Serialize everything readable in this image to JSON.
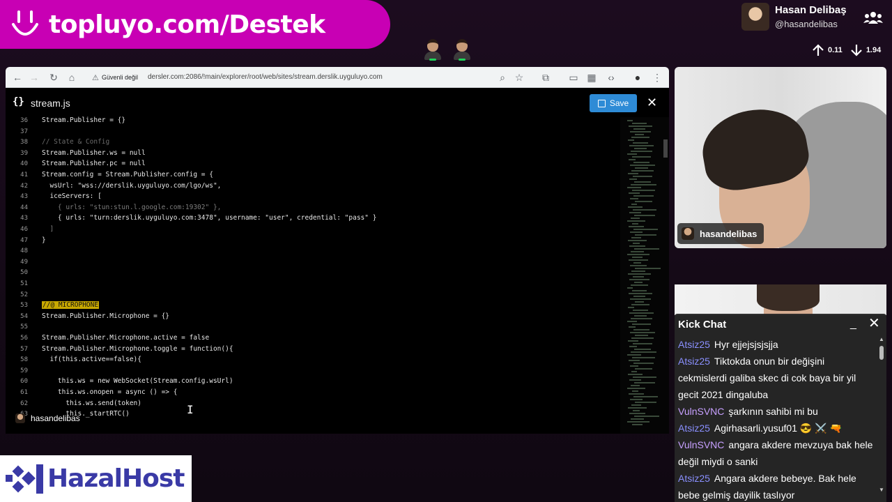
{
  "banner": {
    "text": "topluyo.com/Destek"
  },
  "profile": {
    "name": "Hasan Delibaş",
    "handle": "@hasandelibas",
    "up": "0.11",
    "down": "1.94"
  },
  "browser": {
    "security_label": "Güvenli değil",
    "url": "dersler.com:2086/!main/explorer/root/web/sites/stream.derslik.uyguluyo.com"
  },
  "editor": {
    "file_name": "stream.js",
    "save_label": "Save",
    "overlay_user": "hasandelibas",
    "lines": [
      {
        "n": "36",
        "t": "Stream.Publisher = {}",
        "k": ""
      },
      {
        "n": "37",
        "t": "",
        "k": ""
      },
      {
        "n": "38",
        "t": "// State & Config",
        "k": "c"
      },
      {
        "n": "39",
        "t": "Stream.Publisher.ws = null",
        "k": ""
      },
      {
        "n": "40",
        "t": "Stream.Publisher.pc = null",
        "k": ""
      },
      {
        "n": "41",
        "t": "Stream.config = Stream.Publisher.config = {",
        "k": ""
      },
      {
        "n": "42",
        "t": "  wsUrl: \"wss://derslik.uyguluyo.com/lgo/ws\",",
        "k": ""
      },
      {
        "n": "43",
        "t": "  iceServers: [",
        "k": ""
      },
      {
        "n": "44",
        "t": "    { urls: \"stun:stun.l.google.com:19302\" },",
        "k": "dim"
      },
      {
        "n": "43",
        "t": "    { urls: \"turn:derslik.uyguluyo.com:3478\", username: \"user\", credential: \"pass\" }",
        "k": ""
      },
      {
        "n": "46",
        "t": "  ]",
        "k": "dim"
      },
      {
        "n": "47",
        "t": "}",
        "k": ""
      },
      {
        "n": "48",
        "t": "",
        "k": ""
      },
      {
        "n": "49",
        "t": "",
        "k": ""
      },
      {
        "n": "50",
        "t": "",
        "k": ""
      },
      {
        "n": "51",
        "t": "",
        "k": ""
      },
      {
        "n": "52",
        "t": "",
        "k": ""
      },
      {
        "n": "53",
        "t": "//@ MICROPHONE",
        "k": "hl"
      },
      {
        "n": "54",
        "t": "Stream.Publisher.Microphone = {}",
        "k": ""
      },
      {
        "n": "55",
        "t": "",
        "k": ""
      },
      {
        "n": "56",
        "t": "Stream.Publisher.Microphone.active = false",
        "k": ""
      },
      {
        "n": "57",
        "t": "Stream.Publisher.Microphone.toggle = function(){",
        "k": ""
      },
      {
        "n": "58",
        "t": "  if(this.active==false){",
        "k": ""
      },
      {
        "n": "59",
        "t": "",
        "k": ""
      },
      {
        "n": "60",
        "t": "    this.ws = new WebSocket(Stream.config.wsUrl)",
        "k": ""
      },
      {
        "n": "61",
        "t": "    this.ws.onopen = async () => {",
        "k": ""
      },
      {
        "n": "62",
        "t": "      this.ws.send(token)",
        "k": ""
      },
      {
        "n": "63",
        "t": "      this._startRTC()",
        "k": ""
      }
    ]
  },
  "cam": {
    "name": "hasandelibas"
  },
  "chat": {
    "title": "Kick Chat",
    "messages": [
      {
        "user": "Atsiz25",
        "text": "Hyr ejjejsjsjsjja",
        "v": false
      },
      {
        "user": "Atsiz25",
        "text": "Tiktokda onun bir değişini cekmislerdi galiba skec di cok baya bir yil gecit 2021 dingaluba",
        "v": false
      },
      {
        "user": "VulnSVNC",
        "text": "şarkının sahibi mi bu",
        "v": true
      },
      {
        "user": "Atsiz25",
        "text": "Agirhasarli.yusuf01 😎 ⚔️ 🔫",
        "v": false
      },
      {
        "user": "VulnSVNC",
        "text": "angara akdere mevzuya bak hele değil miydi o sanki",
        "v": true
      },
      {
        "user": "Atsiz25",
        "text": "Angara akdere bebeye. Bak hele bebe gelmiş dayilik taslıyor",
        "v": false
      }
    ]
  },
  "sponsor": {
    "name": "HazalHost"
  }
}
